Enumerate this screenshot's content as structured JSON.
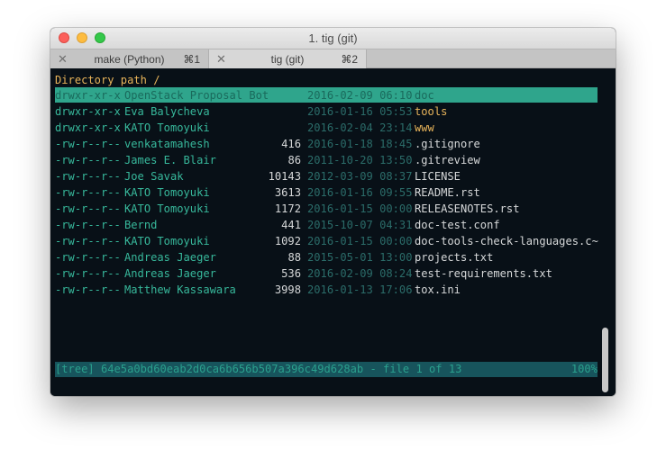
{
  "window": {
    "title": "1. tig (git)"
  },
  "tabs": [
    {
      "label": "make (Python)",
      "shortcut": "⌘1",
      "close": "✕",
      "active": false
    },
    {
      "label": "tig (git)",
      "shortcut": "⌘2",
      "close": "✕",
      "active": true
    }
  ],
  "terminal": {
    "header": "Directory path /",
    "rows": [
      {
        "perm": "drwxr-xr-x",
        "author": "OpenStack Proposal Bot",
        "size": "",
        "date": "2016-02-09 06:10",
        "name": "doc"
      },
      {
        "perm": "drwxr-xr-x",
        "author": "Eva Balycheva",
        "size": "",
        "date": "2016-01-16 05:53",
        "name": "tools"
      },
      {
        "perm": "drwxr-xr-x",
        "author": "KATO Tomoyuki",
        "size": "",
        "date": "2016-02-04 23:14",
        "name": "www"
      },
      {
        "perm": "-rw-r--r--",
        "author": "venkatamahesh",
        "size": "416",
        "date": "2016-01-18 18:45",
        "name": ".gitignore"
      },
      {
        "perm": "-rw-r--r--",
        "author": "James E. Blair",
        "size": "86",
        "date": "2011-10-20 13:50",
        "name": ".gitreview"
      },
      {
        "perm": "-rw-r--r--",
        "author": "Joe Savak",
        "size": "10143",
        "date": "2012-03-09 08:37",
        "name": "LICENSE"
      },
      {
        "perm": "-rw-r--r--",
        "author": "KATO Tomoyuki",
        "size": "3613",
        "date": "2016-01-16 09:55",
        "name": "README.rst"
      },
      {
        "perm": "-rw-r--r--",
        "author": "KATO Tomoyuki",
        "size": "1172",
        "date": "2016-01-15 00:00",
        "name": "RELEASENOTES.rst"
      },
      {
        "perm": "-rw-r--r--",
        "author": "Bernd",
        "size": "441",
        "date": "2015-10-07 04:31",
        "name": "doc-test.conf"
      },
      {
        "perm": "-rw-r--r--",
        "author": "KATO Tomoyuki",
        "size": "1092",
        "date": "2016-01-15 00:00",
        "name": "doc-tools-check-languages.c~"
      },
      {
        "perm": "-rw-r--r--",
        "author": "Andreas Jaeger",
        "size": "88",
        "date": "2015-05-01 13:00",
        "name": "projects.txt"
      },
      {
        "perm": "-rw-r--r--",
        "author": "Andreas Jaeger",
        "size": "536",
        "date": "2016-02-09 08:24",
        "name": "test-requirements.txt"
      },
      {
        "perm": "-rw-r--r--",
        "author": "Matthew Kassawara",
        "size": "3998",
        "date": "2016-01-13 17:06",
        "name": "tox.ini"
      }
    ],
    "status": "[tree] 64e5a0bd60eab2d0ca6b656b507a396c49d628ab - file 1 of 13",
    "status_percent": "100%"
  },
  "colors": {
    "background": "#081017",
    "selection": "#2fa58c",
    "directory": "#e8b45a",
    "accent": "#37b89b",
    "status_bar": "#17545c"
  }
}
